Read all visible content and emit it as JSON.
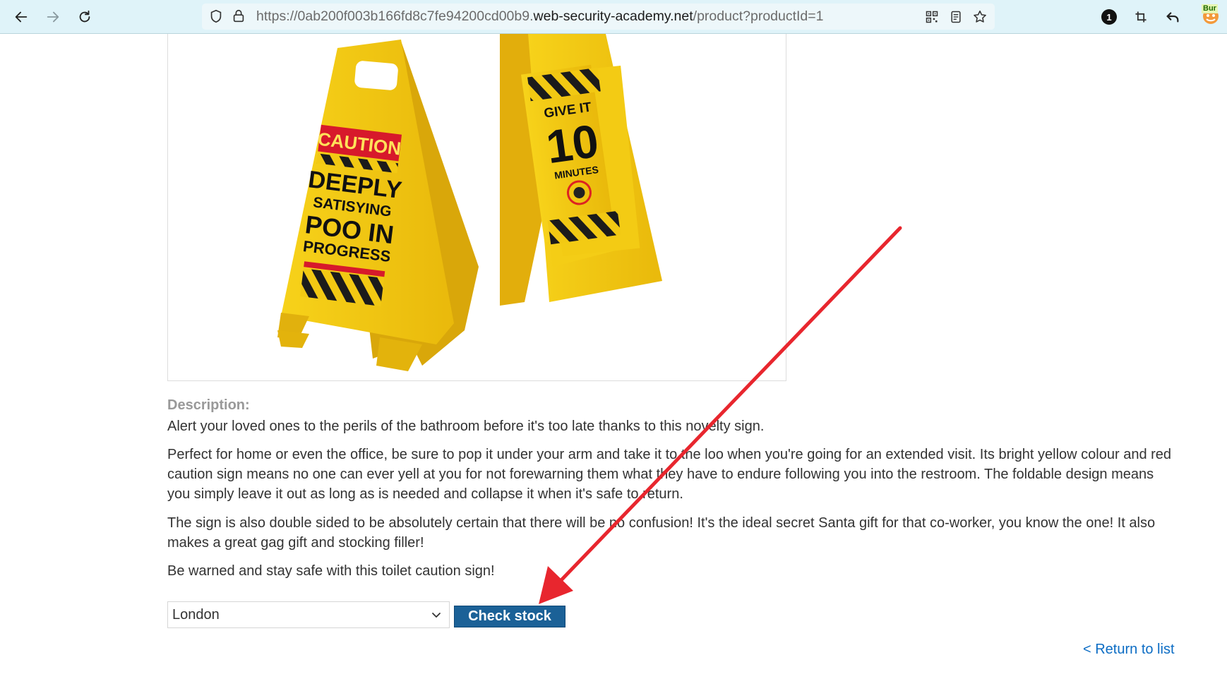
{
  "browser": {
    "url_prefix": "https://0ab200f003b166fd8c7fe94200cd00b9.",
    "url_host": "web-security-academy.net",
    "url_path": "/product?productId=1",
    "extension_badge": "1",
    "burp_label": "Bur"
  },
  "product": {
    "image": {
      "left_sign": {
        "caution": "CAUTION",
        "line1": "DEEPLY",
        "line2": "SATISYING",
        "line3": "POO IN",
        "line4": "PROGRESS"
      },
      "right_sign": {
        "line1": "GIVE IT",
        "number": "10",
        "line3": "MINUTES"
      }
    },
    "description_label": "Description:",
    "paragraphs": [
      "Alert your loved ones to the perils of the bathroom before it's too late thanks to this novelty sign.",
      "Perfect for home or even the office, be sure to pop it under your arm and take it to the loo when you're going for an extended visit. Its bright yellow colour and red caution sign means no one can ever yell at you for not forewarning them what they have to endure following you into the restroom. The foldable design means you simply leave it out as long as is needed and collapse it when it's safe to return.",
      "The sign is also double sided to be absolutely certain that there will be no confusion! It's the ideal secret Santa gift for that co-worker, you know the one! It also makes a great gag gift and stocking filler!",
      "Be warned and stay safe with this toilet caution sign!"
    ]
  },
  "stock": {
    "selected_store": "London",
    "button_label": "Check stock"
  },
  "footer": {
    "return_link": "< Return to list"
  },
  "colors": {
    "button": "#1b6197",
    "link": "#0b6cc4",
    "annotation_arrow": "#e8262e",
    "sign_yellow": "#f2c913"
  }
}
